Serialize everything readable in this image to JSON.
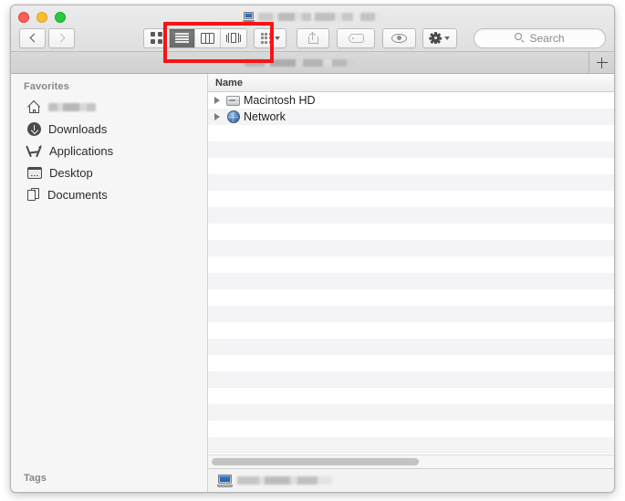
{
  "window": {
    "title_redacted": true,
    "title_icon": "computer-icon",
    "traffic_lights": {
      "close_color": "#ff5f57",
      "minimize_color": "#ffbd2e",
      "zoom_color": "#28c940"
    }
  },
  "toolbar": {
    "back_label": "Back",
    "forward_label": "Forward",
    "view_modes": [
      {
        "name": "icon-view",
        "label": "as Icons",
        "active": false
      },
      {
        "name": "list-view",
        "label": "as List",
        "active": true
      },
      {
        "name": "column-view",
        "label": "as Columns",
        "active": false
      },
      {
        "name": "gallery-view",
        "label": "as Gallery",
        "active": false
      }
    ],
    "arrange_label": "Arrange",
    "share_label": "Share",
    "tag_label": "Edit Tags",
    "quicklook_label": "Quick Look",
    "action_label": "Action",
    "search": {
      "placeholder": "Search",
      "value": "",
      "icon": "search-icon"
    }
  },
  "tabbar": {
    "tab_title_redacted": true,
    "new_tab_label": "+"
  },
  "sidebar": {
    "favorites_header": "Favorites",
    "items": [
      {
        "label": "",
        "icon": "home-icon",
        "redacted": true
      },
      {
        "label": "Downloads",
        "icon": "downloads-icon",
        "redacted": false
      },
      {
        "label": "Applications",
        "icon": "applications-icon",
        "redacted": false
      },
      {
        "label": "Desktop",
        "icon": "desktop-icon",
        "redacted": false
      },
      {
        "label": "Documents",
        "icon": "documents-icon",
        "redacted": false
      }
    ],
    "tags_header": "Tags"
  },
  "filelist": {
    "columns": [
      "Name"
    ],
    "rows": [
      {
        "name": "Macintosh HD",
        "icon": "hard-drive-icon",
        "expandable": true
      },
      {
        "name": "Network",
        "icon": "network-globe-icon",
        "expandable": true
      }
    ],
    "empty_row_count": 21
  },
  "pathbar": {
    "icon": "computer-icon",
    "label_redacted": true
  },
  "annotation": {
    "color": "#f71414",
    "target": "view-mode-segmented-control"
  }
}
